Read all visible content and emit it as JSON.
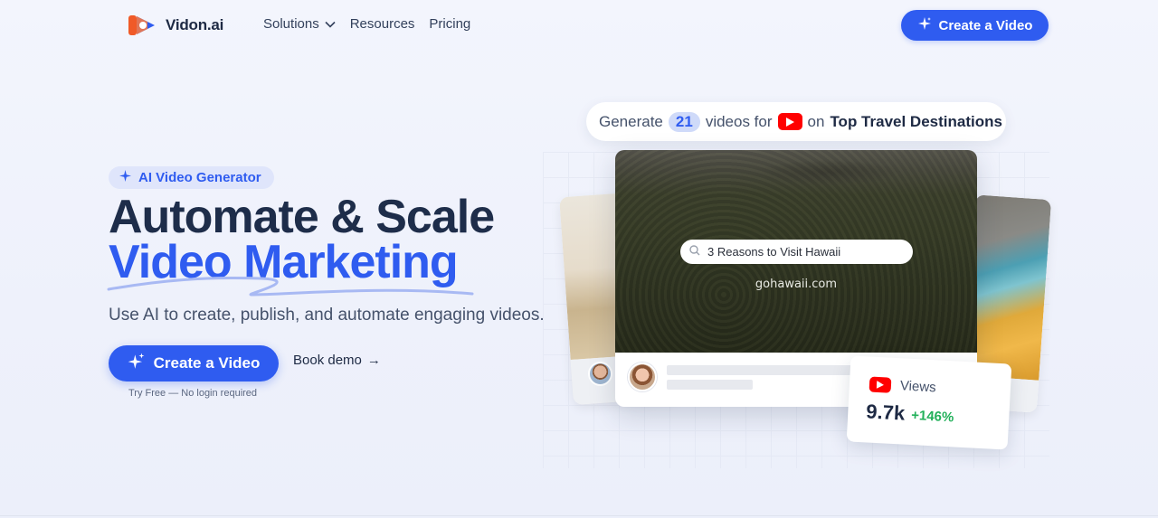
{
  "brand": {
    "name": "Vidon.ai",
    "accent": "#2f5cf0",
    "heading_color": "#1e2d4a"
  },
  "nav": {
    "items": [
      {
        "label": "Solutions",
        "has_dropdown": true,
        "icon": "chevron-down-icon"
      },
      {
        "label": "Resources"
      },
      {
        "label": "Pricing"
      }
    ],
    "cta_label": "Create a Video",
    "cta_icon": "sparkle-icon"
  },
  "hero": {
    "badge": "AI Video Generator",
    "title_line1": "Automate & Scale",
    "title_line2": "Video Marketing",
    "subtitle": "Use AI to create, publish, and automate engaging videos.",
    "cta_label": "Create a Video",
    "secondary_label": "Book demo",
    "secondary_arrow": "→",
    "note": "Try Free — No login required"
  },
  "visual": {
    "prompt": {
      "prefix": "Generate",
      "count": "21",
      "middle": "videos for",
      "platform_icon": "youtube-icon",
      "on": "on",
      "topic": "Top Travel Destinations"
    },
    "video": {
      "search_text": "3 Reasons to Visit Hawaii",
      "domain": "gohawaii.com"
    },
    "stats": {
      "label": "Views",
      "value": "9.7k",
      "delta": "+146%",
      "delta_color": "#22b05a"
    }
  }
}
